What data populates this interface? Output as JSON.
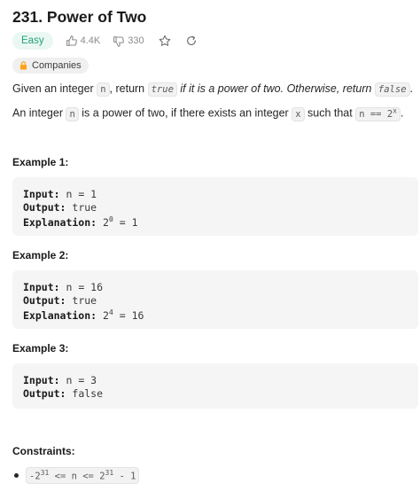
{
  "problem": {
    "title": "231. Power of Two",
    "difficulty": "Easy",
    "likes": "4.4K",
    "dislikes": "330",
    "companies_label": "Companies"
  },
  "description": {
    "p1": {
      "a": "Given an integer ",
      "n": "n",
      "b": ", return ",
      "true": "true",
      "c": " if it is a power of two. Otherwise, return ",
      "false": "false",
      "d": "."
    },
    "p2": {
      "a": "An integer ",
      "n": "n",
      "b": " is a power of two, if there exists an integer ",
      "x": "x",
      "c": " such that ",
      "expr": "n == 2",
      "expr_sup": "x",
      "d": "."
    }
  },
  "examples": [
    {
      "title": "Example 1:",
      "input_label": "Input:",
      "input": "n = 1",
      "output_label": "Output:",
      "output": "true",
      "explanation_label": "Explanation:",
      "explanation_base": "2",
      "explanation_exp": "0",
      "explanation_rest": " = 1"
    },
    {
      "title": "Example 2:",
      "input_label": "Input:",
      "input": "n = 16",
      "output_label": "Output:",
      "output": "true",
      "explanation_label": "Explanation:",
      "explanation_base": "2",
      "explanation_exp": "4",
      "explanation_rest": " = 16"
    },
    {
      "title": "Example 3:",
      "input_label": "Input:",
      "input": "n = 3",
      "output_label": "Output:",
      "output": "false"
    }
  ],
  "constraints": {
    "title": "Constraints:",
    "item": {
      "a": "-2",
      "a_sup": "31",
      "b": " <= n <= 2",
      "b_sup": "31",
      "c": " - 1"
    }
  },
  "icons": {
    "like": "thumbs-up-icon",
    "dislike": "thumbs-down-icon",
    "star": "star-icon",
    "share": "share-icon",
    "lock": "lock-icon"
  },
  "colors": {
    "easy_text": "#1fa27b",
    "easy_bg": "#ebf7f2",
    "lock": "#ffa116"
  }
}
